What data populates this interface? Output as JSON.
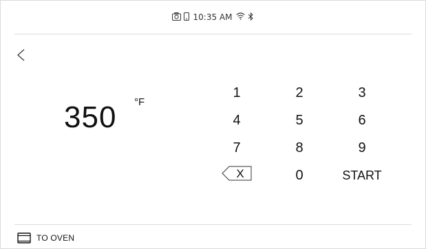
{
  "status_bar": {
    "time": "10:35 AM",
    "icons": [
      "camera-icon",
      "phone-icon",
      "wifi-icon",
      "bluetooth-icon"
    ]
  },
  "navigation": {
    "back_icon": "chevron-left-icon"
  },
  "temperature": {
    "value": "350",
    "unit": "°F"
  },
  "keypad": {
    "keys": [
      "1",
      "2",
      "3",
      "4",
      "5",
      "6",
      "7",
      "8",
      "9",
      "0"
    ],
    "backspace_label": "X",
    "start_label": "START"
  },
  "footer": {
    "label": "TO OVEN",
    "icon": "oven-icon"
  }
}
